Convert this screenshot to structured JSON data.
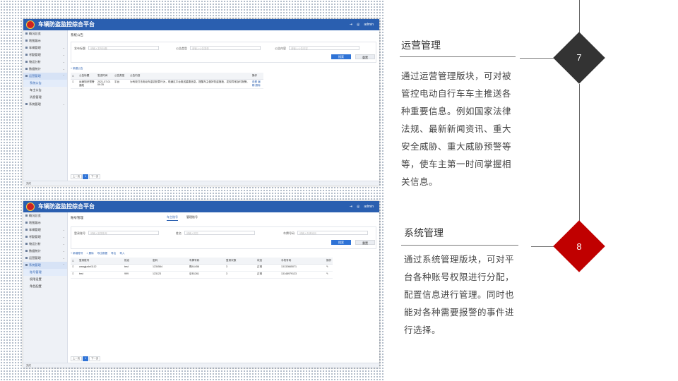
{
  "app": {
    "title": "车辆防盗监控综合平台",
    "user": "admin"
  },
  "sidebar": {
    "items": [
      "概况总览",
      "地图展示",
      "车辆管理",
      "考勤管理",
      "物运分析",
      "数据统计",
      "运营管理",
      "系统管理"
    ]
  },
  "screen1": {
    "breadcrumb": "系统公告",
    "active_menu": "运营管理",
    "subitems": [
      "系统公告",
      "车主公告",
      "消息管理"
    ],
    "filters": [
      {
        "label": "发布标题",
        "placeholder": "请输入发布标题"
      },
      {
        "label": "公告类型",
        "placeholder": "请输入公告类型"
      },
      {
        "label": "公告内容",
        "placeholder": "请输入公告内容"
      }
    ],
    "search_label": "搜索",
    "reset_label": "重置",
    "tool_add": "+ 新建公告",
    "columns": [
      "公告标题",
      "发送时间",
      "公告类型",
      "公告内容",
      "操作"
    ],
    "rows": [
      {
        "title": "运营知识预警通知",
        "time": "2021-07-01 09:35",
        "type": "平台",
        "content": "为有效打击电动车盗窃犯罪行为，现通过平台推送重要信息，提醒车主做好防盗措施，发现异常及时报警。",
        "ops": "查看 编辑 删除"
      }
    ],
    "pager": {
      "prev": "上一页",
      "current": "1",
      "next": "下一页"
    },
    "status": "完成"
  },
  "screen2": {
    "breadcrumb": "账号管理",
    "active_menu": "系统管理",
    "tabs": [
      "车主账号",
      "管理账号"
    ],
    "subitems": [
      "账号管理",
      "权限设置",
      "角色配置"
    ],
    "filters": [
      {
        "label": "登录账号",
        "placeholder": "请输入登录账号"
      },
      {
        "label": "姓名",
        "placeholder": "请输入姓名"
      },
      {
        "label": "车牌号码",
        "placeholder": "请输入车牌号码"
      }
    ],
    "search_label": "搜索",
    "reset_label": "重置",
    "tools": [
      "+ 新增账号",
      "× 删除",
      "导出数据",
      "导出",
      "导入"
    ],
    "columns": [
      "",
      "登录账号",
      "姓名",
      "密码",
      "车牌号码",
      "登录次数",
      "状态",
      "手机号码",
      "操作"
    ],
    "rows": [
      {
        "account": "wangjunlei1112",
        "name": "test",
        "password": "1234564",
        "plate": "豫A1456",
        "logins": "3",
        "status": "正常",
        "phone": "13132665071",
        "op": "✎"
      },
      {
        "account": "test",
        "name": "999",
        "password": "123123",
        "plate": "京B1261",
        "logins": "3",
        "status": "正常",
        "phone": "13148979123",
        "op": "✎"
      }
    ],
    "pager": {
      "prev": "上一页",
      "current": "1",
      "next": "下一页"
    },
    "status": "完成"
  },
  "section7": {
    "number": "7",
    "title": "运营管理",
    "lines": [
      "通过运营管理版块，可对被",
      "管控电动自行车车主推送各",
      "种重要信息。例如国家法律",
      "法规、最新新闻资讯、重大",
      "安全威胁、重大威胁预警等",
      "等，使车主第一时间掌握相",
      "关信息。"
    ],
    "color": "#333333"
  },
  "section8": {
    "number": "8",
    "title": "系统管理",
    "lines": [
      "通过系统管理版块，可对平",
      "台各种账号权限进行分配，",
      "配置信息进行管理。同时也",
      "能对各种需要报警的事件进",
      "行选择。"
    ],
    "color": "#c00000"
  }
}
